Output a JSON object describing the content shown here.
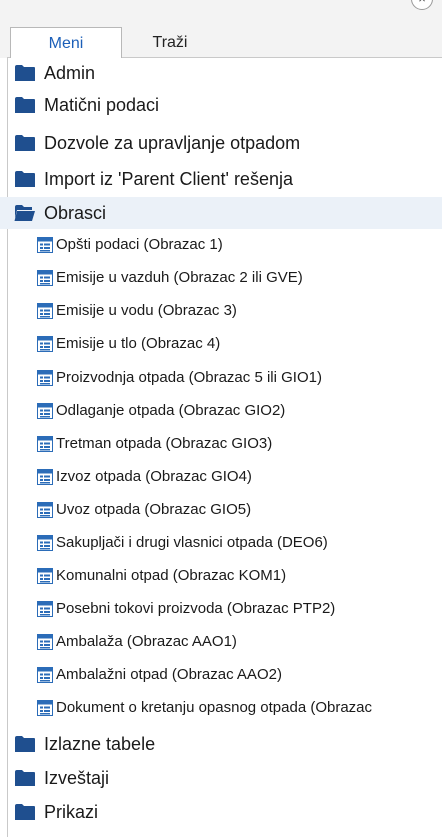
{
  "window": {
    "close_glyph": "×"
  },
  "tabs": [
    {
      "label": "Meni",
      "active": true
    },
    {
      "label": "Traži",
      "active": false
    }
  ],
  "icons": {
    "folder": "folder-icon",
    "form": "form-icon",
    "folder_color": "#1f4f8f",
    "form_color": "#2b6cb8"
  },
  "tree": {
    "folders_top": [
      {
        "label": "Admin"
      },
      {
        "label": "Matični podaci"
      },
      {
        "label": "Dozvole za upravljanje otpadom"
      },
      {
        "label": "Import iz 'Parent Client' rešenja"
      }
    ],
    "open_folder": {
      "label": "Obrasci",
      "selected": true,
      "items": [
        {
          "label": "Opšti podaci (Obrazac 1)"
        },
        {
          "label": "Emisije u vazduh (Obrazac 2 ili GVE)"
        },
        {
          "label": "Emisije u vodu (Obrazac 3)"
        },
        {
          "label": "Emisije u tlo (Obrazac 4)"
        },
        {
          "label": "Proizvodnja otpada (Obrazac 5 ili GIO1)"
        },
        {
          "label": "Odlaganje otpada (Obrazac GIO2)"
        },
        {
          "label": "Tretman otpada (Obrazac GIO3)"
        },
        {
          "label": "Izvoz otpada (Obrazac GIO4)"
        },
        {
          "label": "Uvoz otpada (Obrazac GIO5)"
        },
        {
          "label": "Sakupljači i drugi vlasnici otpada (DEO6)"
        },
        {
          "label": "Komunalni otpad (Obrazac KOM1)"
        },
        {
          "label": "Posebni tokovi proizvoda (Obrazac PTP2)"
        },
        {
          "label": "Ambalaža (Obrazac AAO1)"
        },
        {
          "label": "Ambalažni otpad (Obrazac AAO2)"
        },
        {
          "label": "Dokument o kretanju opasnog otpada (Obrazac"
        }
      ]
    },
    "folders_bottom": [
      {
        "label": "Izlazne tabele"
      },
      {
        "label": "Izveštaji"
      },
      {
        "label": "Prikazi"
      }
    ]
  }
}
